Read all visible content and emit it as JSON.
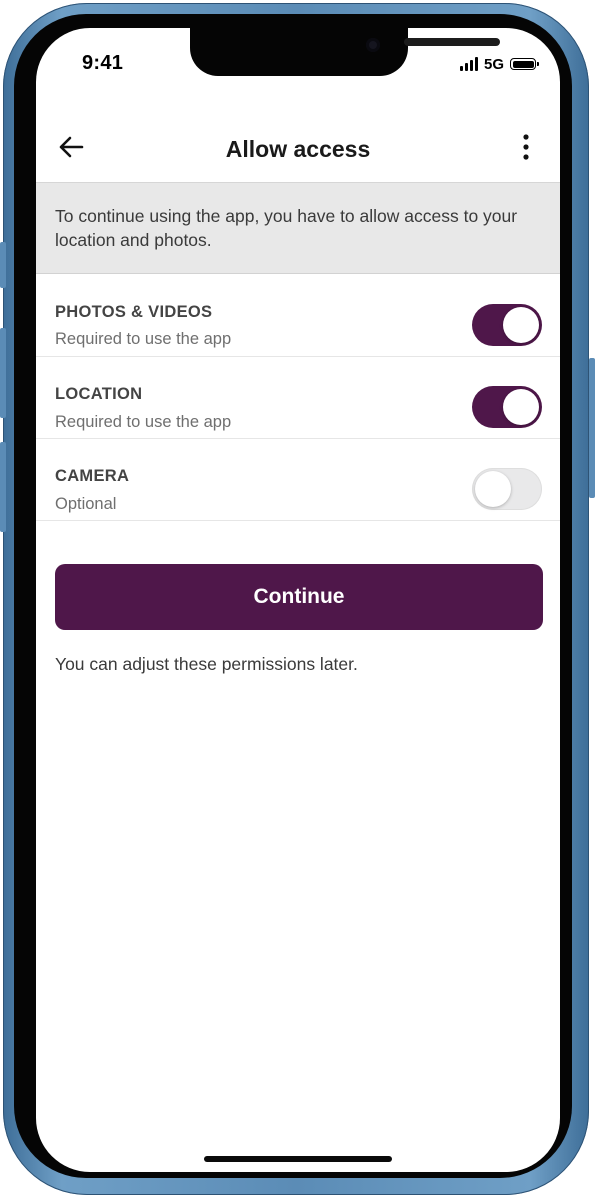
{
  "status_bar": {
    "time": "9:41",
    "network": "5G",
    "signal_icon": "cellular-signal-icon",
    "battery_icon": "battery-full-icon"
  },
  "header": {
    "title": "Allow access",
    "back_icon": "arrow-left-icon",
    "menu_icon": "vertical-ellipsis-icon"
  },
  "notice": {
    "text": "To continue using the app, you have to allow access to your location and photos."
  },
  "permissions": [
    {
      "name": "PHOTOS & VIDEOS",
      "description": "Required to use the app",
      "enabled": true
    },
    {
      "name": "LOCATION",
      "description": "Required to use the app",
      "enabled": true
    },
    {
      "name": "CAMERA",
      "description": "Optional",
      "enabled": false
    }
  ],
  "continue_label": "Continue",
  "footnote": "You can adjust these permissions later.",
  "colors": {
    "accent": "#4f174a",
    "banner_bg": "#e8e8e8",
    "toggle_off": "#e9e9ea",
    "frame": "#5b8cb6"
  }
}
